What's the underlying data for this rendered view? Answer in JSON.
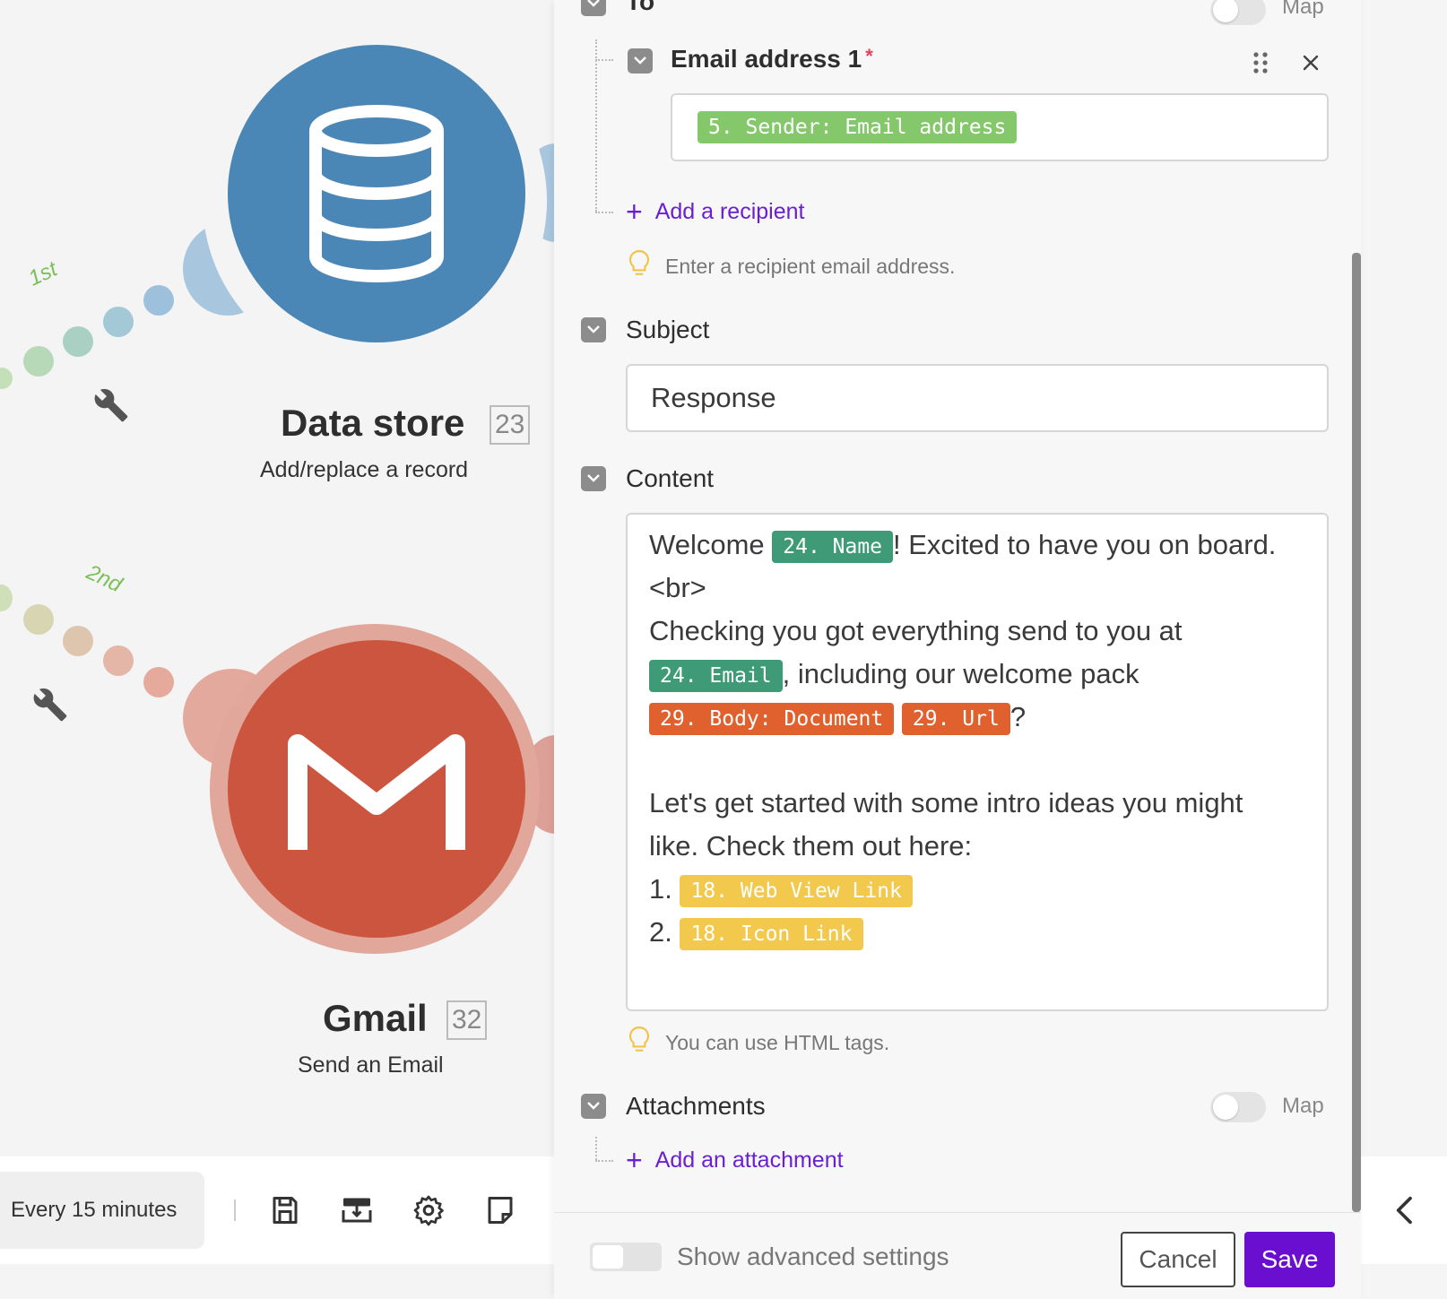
{
  "canvas": {
    "route_1_label": "1st",
    "route_2_label": "2nd",
    "module_1": {
      "name": "Data store",
      "id": "23",
      "action": "Add/replace a record",
      "color": "#4a87b6"
    },
    "module_2": {
      "name": "Gmail",
      "id": "32",
      "action": "Send an Email",
      "color": "#cc5540"
    }
  },
  "toolbar": {
    "schedule": "Every 15 minutes",
    "icons": [
      "save-icon",
      "flow-control-icon",
      "settings-icon",
      "notes-icon"
    ]
  },
  "panel": {
    "to": {
      "label": "To",
      "required": "*",
      "map_label": "Map"
    },
    "email_address": {
      "label": "Email address 1",
      "required": "*",
      "value_pill": "5. Sender: Email address"
    },
    "add_recipient": "Add a recipient",
    "recipient_hint": "Enter a recipient email address.",
    "subject": {
      "label": "Subject",
      "value": "Response"
    },
    "content": {
      "label": "Content",
      "text_1": "Welcome ",
      "pill_name": "24. Name",
      "text_2": "! Excited to have you on board.",
      "text_3": "<br>",
      "text_4": "Checking you got everything send to you at",
      "pill_email": "24. Email",
      "text_5": ", including our welcome pack",
      "pill_body": "29. Body: Document",
      "pill_url": "29. Url",
      "text_6": "?",
      "text_7": "Let's get started with some intro ideas you might like. Check them out here:",
      "item_1_num": "1.",
      "pill_web_view": "18. Web View Link",
      "item_2_num": "2.",
      "pill_icon_link": "18. Icon Link",
      "hint": "You can use HTML tags."
    },
    "attachments": {
      "label": "Attachments",
      "map_label": "Map"
    },
    "add_attachment": "Add an attachment"
  },
  "footer": {
    "advanced_label": "Show advanced settings",
    "cancel": "Cancel",
    "save": "Save"
  },
  "colors": {
    "accent": "#6a0fcf",
    "pill_green": "#85c86c",
    "pill_teal": "#3e9a77",
    "pill_orange": "#e0602e",
    "pill_yellow": "#f2c94c"
  }
}
